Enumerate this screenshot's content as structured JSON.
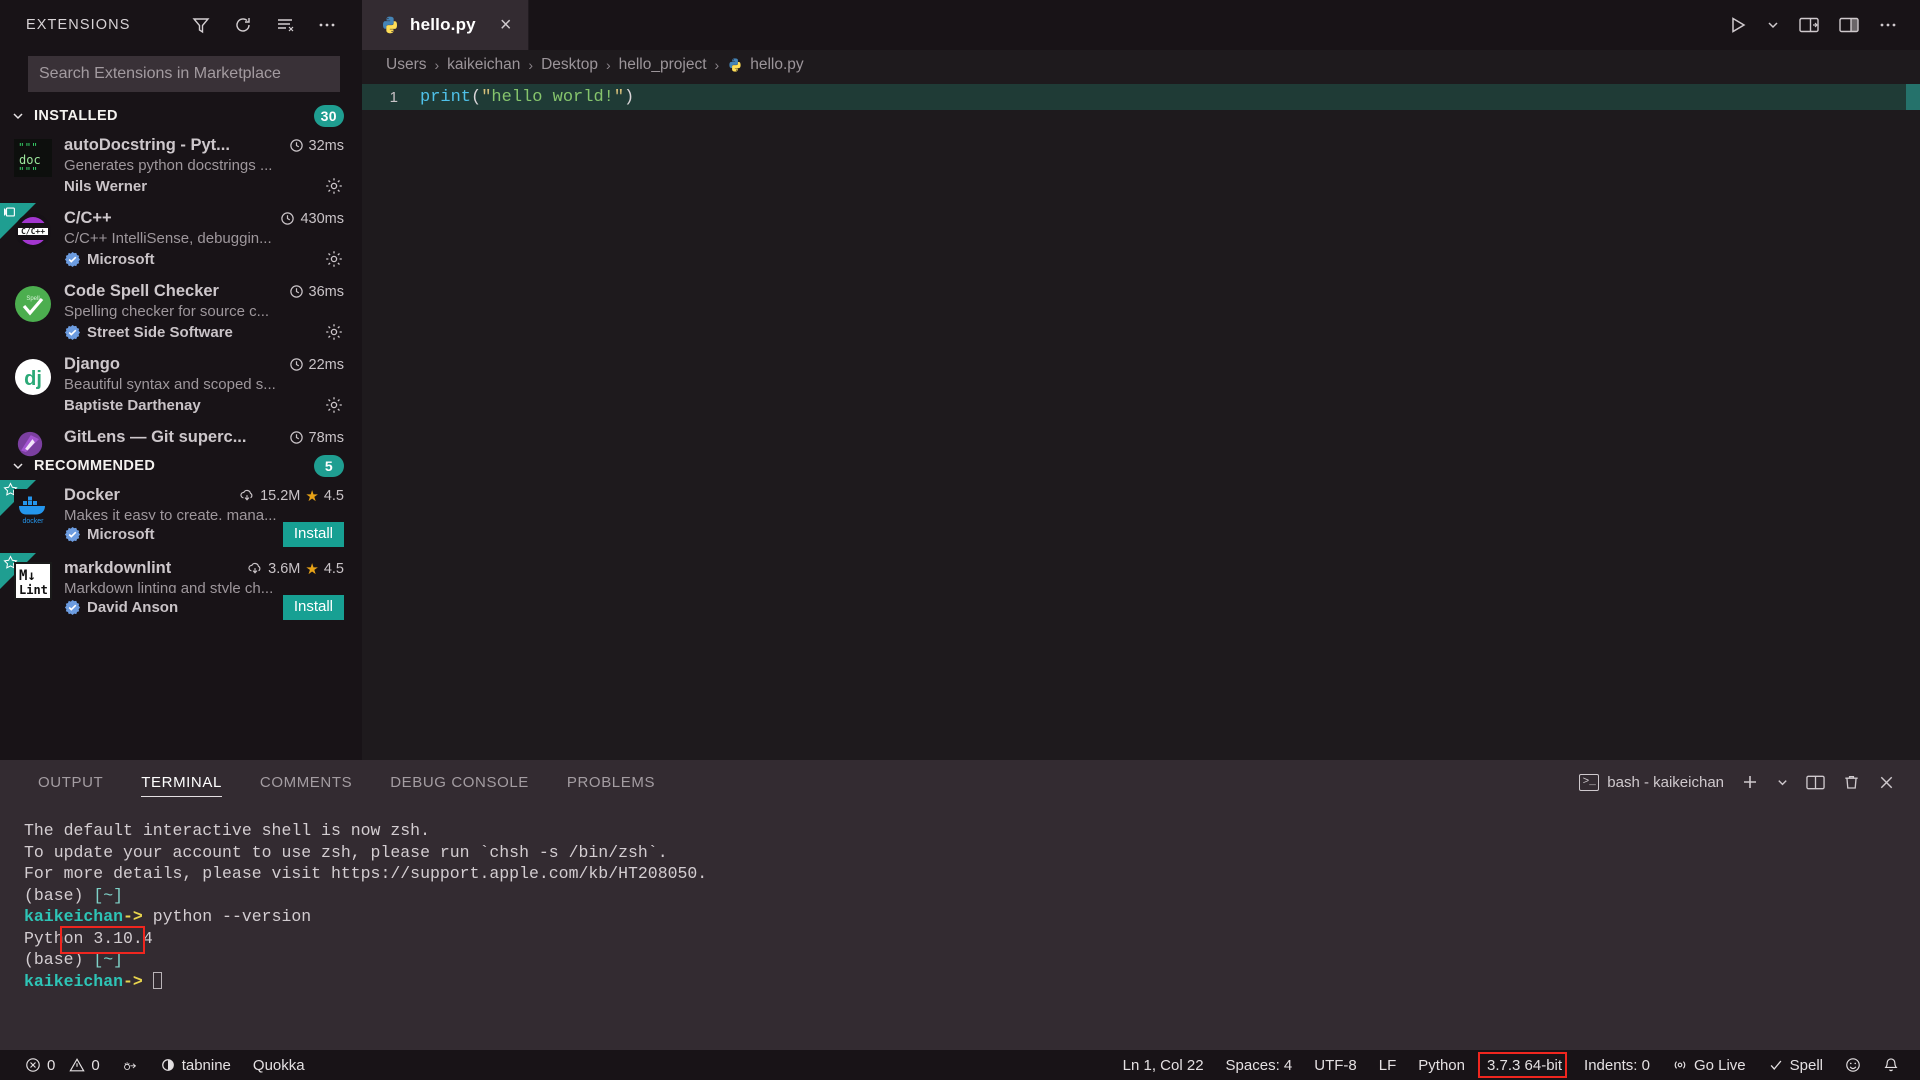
{
  "sidebar": {
    "title": "EXTENSIONS",
    "actions": [
      {
        "name": "filter-icon",
        "label": "Filter Extensions"
      },
      {
        "name": "refresh-icon",
        "label": "Refresh"
      },
      {
        "name": "clear-search-icon",
        "label": "Clear Search Results"
      },
      {
        "name": "more-actions-icon",
        "label": "Views and More Actions"
      }
    ],
    "search": {
      "placeholder": "Search Extensions in Marketplace",
      "value": ""
    },
    "sections": [
      {
        "label": "INSTALLED",
        "count": "30"
      },
      {
        "label": "RECOMMENDED",
        "count": "5"
      }
    ],
    "installed": [
      {
        "name": "autoDocstring - Pyt...",
        "description": "Generates python docstrings ...",
        "publisher": "Nils Werner",
        "verified": false,
        "time": "32ms",
        "icon": "autodocstring-icon",
        "gear": true
      },
      {
        "name": "C/C++",
        "description": "C/C++ IntelliSense, debuggin...",
        "publisher": "Microsoft",
        "verified": true,
        "time": "430ms",
        "icon": "cpp-icon",
        "gear": true,
        "ribbon": "remote-ribbon"
      },
      {
        "name": "Code Spell Checker",
        "description": "Spelling checker for source c...",
        "publisher": "Street Side Software",
        "verified": true,
        "time": "36ms",
        "icon": "spell-icon",
        "gear": true
      },
      {
        "name": "Django",
        "description": "Beautiful syntax and scoped s...",
        "publisher": "Baptiste Darthenay",
        "verified": false,
        "time": "22ms",
        "icon": "django-icon",
        "gear": true
      },
      {
        "name": "GitLens — Git superc...",
        "description": "",
        "publisher": "",
        "verified": false,
        "time": "78ms",
        "icon": "gitlens-icon",
        "gear": false
      }
    ],
    "recommended": [
      {
        "name": "Docker",
        "description": "Makes it easy to create, mana...",
        "publisher": "Microsoft",
        "verified": true,
        "downloads": "15.2M",
        "rating": "4.5",
        "install_label": "Install",
        "icon": "docker-icon",
        "ribbon": "star-ribbon"
      },
      {
        "name": "markdownlint",
        "description": "Markdown linting and style ch...",
        "publisher": "David Anson",
        "verified": true,
        "downloads": "3.6M",
        "rating": "4.5",
        "install_label": "Install",
        "icon": "markdownlint-icon",
        "ribbon": "star-ribbon"
      }
    ]
  },
  "tabs": {
    "open": [
      {
        "label": "hello.py",
        "icon": "python-file-icon",
        "active": true,
        "close": "×"
      }
    ],
    "tools": [
      {
        "name": "run-python-file-icon"
      },
      {
        "name": "run-dropdown-chevron-icon"
      },
      {
        "name": "split-editor-right-icon"
      },
      {
        "name": "toggle-panel-icon"
      },
      {
        "name": "editor-more-actions-icon"
      }
    ]
  },
  "breadcrumb": {
    "separator": "›",
    "items": [
      "Users",
      "kaikeichan",
      "Desktop",
      "hello_project"
    ],
    "file": "hello.py"
  },
  "editor": {
    "line_number": "1",
    "code": {
      "fn": "print",
      "open_paren": "(",
      "quote_open": "\"",
      "string": "hello world!",
      "quote_close": "\"",
      "close_paren": ")"
    }
  },
  "panel": {
    "tabs": [
      {
        "label": "OUTPUT",
        "active": false
      },
      {
        "label": "TERMINAL",
        "active": true
      },
      {
        "label": "COMMENTS",
        "active": false
      },
      {
        "label": "DEBUG CONSOLE",
        "active": false
      },
      {
        "label": "PROBLEMS",
        "active": false
      }
    ],
    "terminal_selector": "bash - kaikeichan",
    "right_actions": [
      {
        "name": "new-terminal-icon",
        "label": "+"
      },
      {
        "name": "terminal-dropdown-chevron-icon"
      },
      {
        "name": "split-terminal-icon"
      },
      {
        "name": "kill-terminal-icon"
      },
      {
        "name": "close-panel-icon"
      }
    ],
    "terminal": {
      "lines": [
        "The default interactive shell is now zsh.",
        "To update your account to use zsh, please run `chsh -s /bin/zsh`.",
        "For more details, please visit https://support.apple.com/kb/HT208050."
      ],
      "prompt_env": "(base)",
      "prompt_path": "[~]",
      "user": "kaikeichan",
      "arrow": "->",
      "command": "python --version",
      "output_prefix": "Python ",
      "output_version": "3.10.4",
      "highlight_color": "#f0261f"
    }
  },
  "status_bar": {
    "left": [
      {
        "name": "error-count",
        "icon": "error-circle-icon",
        "value": "0"
      },
      {
        "name": "warning-count",
        "icon": "warning-triangle-icon",
        "value": "0"
      },
      {
        "name": "debug-bug-icon",
        "value": ""
      },
      {
        "name": "tabnine",
        "icon": "tabnine-icon",
        "value": "tabnine"
      },
      {
        "name": "quokka",
        "value": "Quokka"
      }
    ],
    "right": [
      {
        "name": "cursor-position",
        "value": "Ln 1, Col 22"
      },
      {
        "name": "indentation",
        "value": "Spaces: 4"
      },
      {
        "name": "encoding",
        "value": "UTF-8"
      },
      {
        "name": "eol",
        "value": "LF"
      },
      {
        "name": "language-mode",
        "value": "Python"
      },
      {
        "name": "python-interpreter",
        "value": "3.7.3 64-bit",
        "highlighted": true
      },
      {
        "name": "indents",
        "value": "Indents: 0"
      },
      {
        "name": "go-live",
        "value": "Go Live",
        "icon": "broadcast-icon"
      },
      {
        "name": "spell-checker",
        "value": "Spell",
        "icon": "check-icon"
      },
      {
        "name": "feedback-smiley-icon",
        "value": ""
      },
      {
        "name": "notifications-bell-icon",
        "value": ""
      }
    ]
  },
  "colors": {
    "accent_teal": "#1f9e91",
    "install_btn": "#17a093",
    "sidebar_bg": "#181317",
    "panel_bg": "#332b31",
    "editor_bg": "#1e1a1d",
    "highlight_red": "#f0261f",
    "code_line_bg": "#1f3b36"
  }
}
